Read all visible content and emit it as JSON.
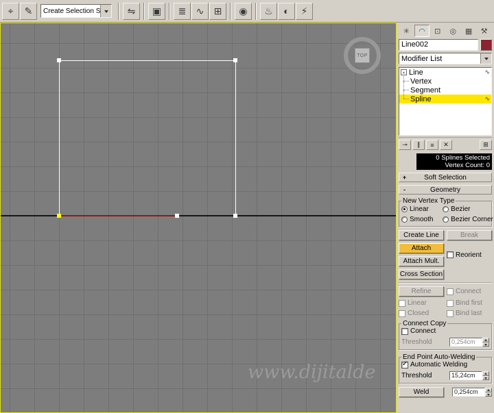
{
  "colors": {
    "panel_bg": "#d4d0c8",
    "viewport_bg": "#7d7d7d",
    "grid_line": "#6f6f6f",
    "axis_line": "#161616",
    "selected_segment": "#9e1510",
    "vertex": "#ffffff",
    "selected_vertex": "#ffff00",
    "stack_highlight": "#ffe600",
    "attach_active": "#f0bd3e",
    "object_color": "#8b2430",
    "viewport_border": "#e3e300",
    "status_bg": "#000000"
  },
  "toolbar": {
    "selection_set_value": "Create Selection Se",
    "icons": {
      "manipulate": "⌖",
      "named_sets": "✎",
      "mirror": "⇋",
      "align": "▣",
      "layers": "≣",
      "curve_editor": "∿",
      "schematic": "⊞",
      "material": "◉",
      "render_setup": "♨",
      "render_frame": "◐",
      "quick_render": "⚡"
    }
  },
  "viewport": {
    "viewcube_label": "TOP",
    "watermark": "www.dijitalde"
  },
  "panel": {
    "tabs": {
      "create": "✳",
      "modify": "◠",
      "hierarchy": "⊡",
      "motion": "◎",
      "display": "▦",
      "utilities": "⚒"
    },
    "object_name": "Line002",
    "modifier_list": "Modifier List",
    "stack": {
      "expander": "-",
      "root": "Line",
      "levels": {
        "vertex": "Vertex",
        "segment": "Segment",
        "spline": "Spline"
      },
      "level_icon": "∿"
    },
    "stack_tools": {
      "pin": "⊸",
      "show_end": "∥",
      "unique": "≡",
      "remove": "✕",
      "configure": "⊞"
    },
    "status": {
      "line1": "0 Splines Selected",
      "line2": "Vertex Count: 0"
    },
    "rollouts": {
      "soft_selection": {
        "state": "+",
        "label": "Soft Selection"
      },
      "geometry": {
        "state": "-",
        "label": "Geometry"
      }
    },
    "new_vertex_type": {
      "title": "New Vertex Type",
      "linear": "Linear",
      "bezier": "Bezier",
      "smooth": "Smooth",
      "bezier_corner": "Bezier Corner"
    },
    "buttons": {
      "create_line": "Create Line",
      "break": "Break",
      "attach": "Attach",
      "attach_mult": "Attach Mult.",
      "reorient": "Reorient",
      "cross_section": "Cross Section",
      "refine": "Refine",
      "connect": "Connect",
      "linear": "Linear",
      "bind_first": "Bind first",
      "closed": "Closed",
      "bind_last": "Bind last"
    },
    "connect_copy": {
      "title": "Connect Copy",
      "connect": "Connect",
      "threshold": "Threshold",
      "value": "0,254cm"
    },
    "end_welding": {
      "title": "End Point Auto-Welding",
      "auto_weld": "Automatic Welding",
      "threshold": "Threshold",
      "value": "15,24cm"
    },
    "weld": {
      "label": "Weld",
      "value": "0,254cm"
    }
  }
}
